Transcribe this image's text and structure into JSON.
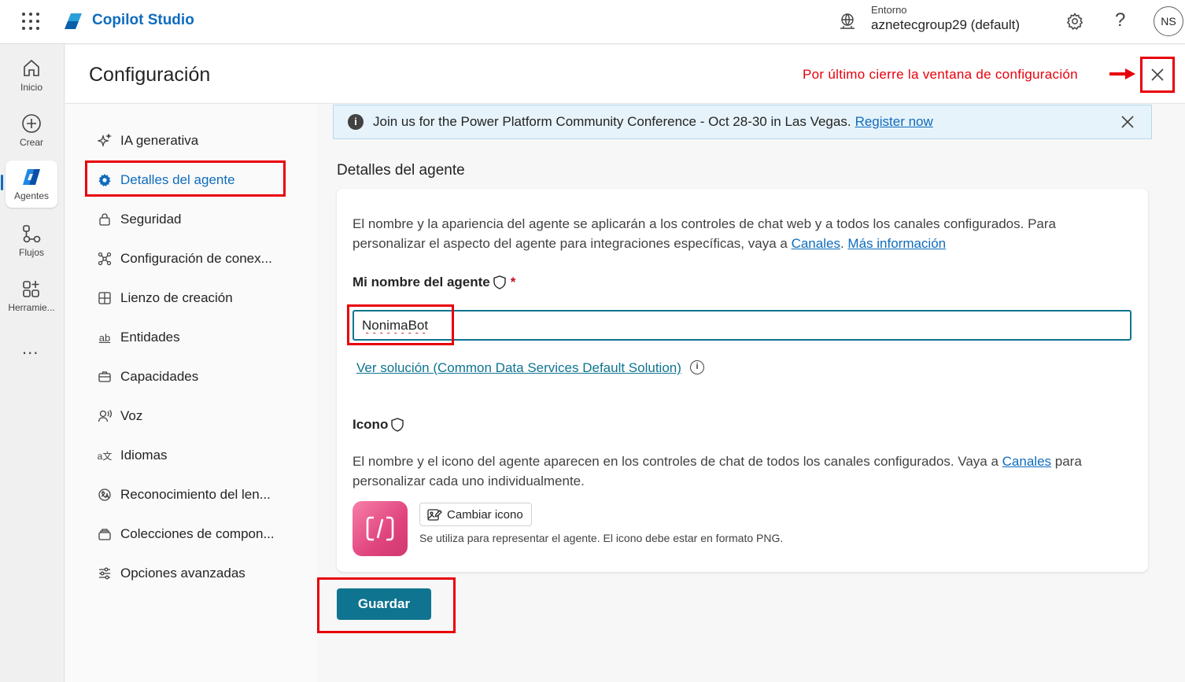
{
  "app": {
    "name": "Copilot Studio"
  },
  "environment": {
    "label": "Entorno",
    "value": "aznetecgroup29 (default)"
  },
  "user": {
    "initials": "NS"
  },
  "rail": {
    "items": [
      {
        "label": "Inicio",
        "icon": "home-icon"
      },
      {
        "label": "Crear",
        "icon": "add-circle-icon"
      },
      {
        "label": "Agentes",
        "icon": "agents-icon",
        "active": true
      },
      {
        "label": "Flujos",
        "icon": "flows-icon"
      },
      {
        "label": "Herramie...",
        "icon": "tools-icon"
      }
    ],
    "more": "..."
  },
  "header": {
    "title": "Configuración",
    "instruction": "Por último cierre la ventana de configuración"
  },
  "nav": {
    "items": [
      {
        "label": "IA generativa",
        "icon": "sparkle-icon"
      },
      {
        "label": "Detalles del agente",
        "icon": "gear-icon",
        "active": true
      },
      {
        "label": "Seguridad",
        "icon": "lock-icon"
      },
      {
        "label": "Configuración de conex...",
        "icon": "connection-icon"
      },
      {
        "label": "Lienzo de creación",
        "icon": "canvas-icon"
      },
      {
        "label": "Entidades",
        "icon": "entities-icon"
      },
      {
        "label": "Capacidades",
        "icon": "briefcase-icon"
      },
      {
        "label": "Voz",
        "icon": "voice-icon"
      },
      {
        "label": "Idiomas",
        "icon": "language-icon"
      },
      {
        "label": "Reconocimiento del len...",
        "icon": "language-recognition-icon"
      },
      {
        "label": "Colecciones de compon...",
        "icon": "collections-icon"
      },
      {
        "label": "Opciones avanzadas",
        "icon": "settings-sliders-icon"
      }
    ]
  },
  "banner": {
    "text": "Join us for the Power Platform Community Conference - Oct 28-30 in Las Vegas.",
    "link": "Register now"
  },
  "details": {
    "section_title": "Detalles del agente",
    "description_prefix": "El nombre y la apariencia del agente se aplicarán a los controles de chat web y a todos los canales configurados. Para personalizar el aspecto del agente para integraciones específicas, vaya a ",
    "description_link1": "Canales",
    "description_mid": ". ",
    "description_link2": "Más información",
    "name_label": "Mi nombre del agente",
    "name_required": "*",
    "name_value": "NonimaBot",
    "solution_link": "Ver solución (Common Data Services Default Solution)",
    "icon_label": "Icono",
    "icon_desc_prefix": "El nombre y el icono del agente aparecen en los controles de chat de todos los canales configurados. Vaya a ",
    "icon_desc_link": "Canales",
    "icon_desc_suffix": " para personalizar cada uno individualmente.",
    "change_icon_label": "Cambiar icono",
    "icon_hint": "Se utiliza para representar el agente. El icono debe estar en formato PNG."
  },
  "actions": {
    "save_label": "Guardar"
  },
  "colors": {
    "accent": "#0f6cbd",
    "primary_button": "#0e7490",
    "annotation": "#e8000b"
  }
}
